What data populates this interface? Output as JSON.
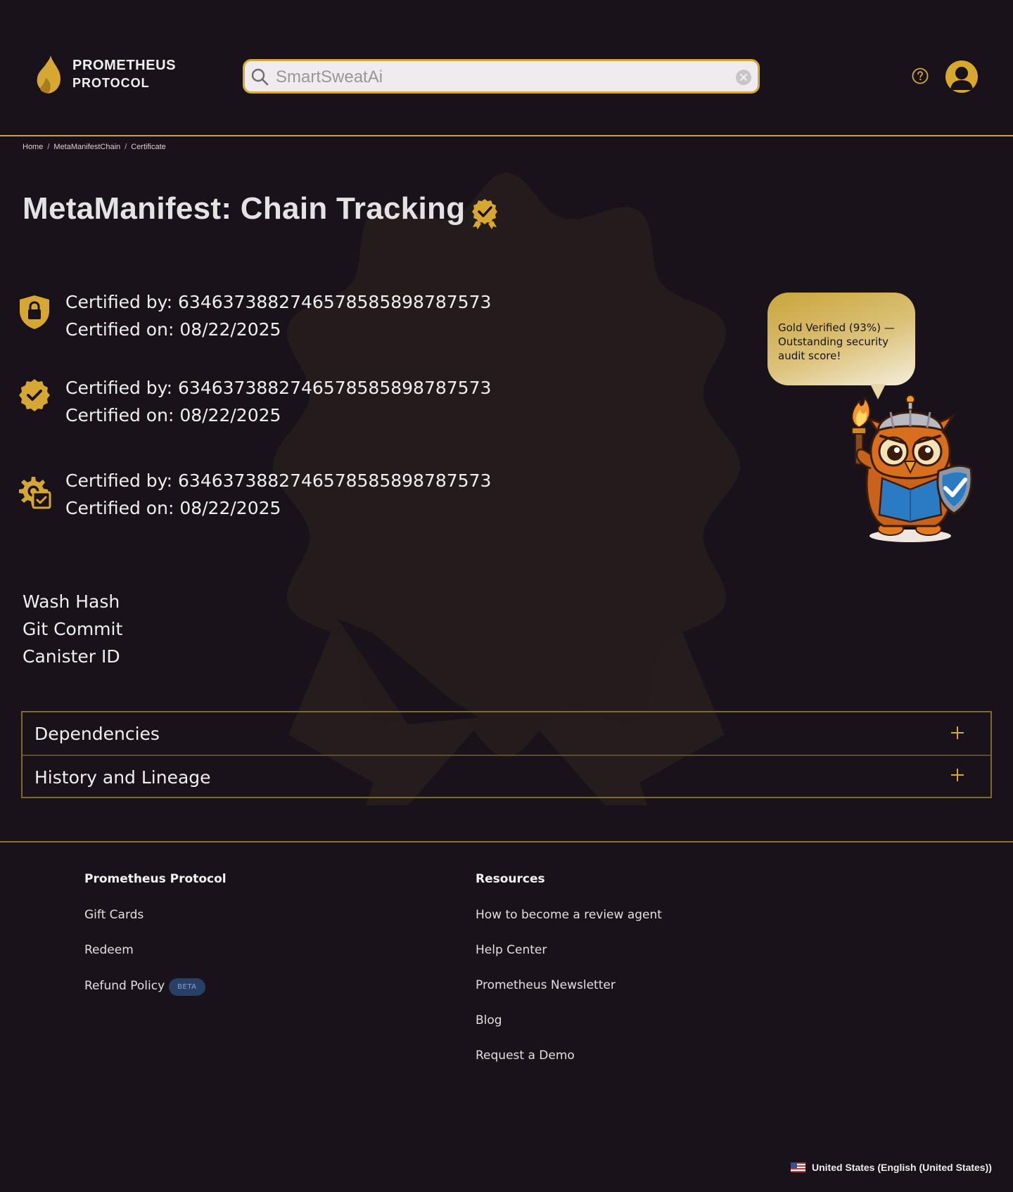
{
  "header": {
    "logo_line1": "PROMETHEUS",
    "logo_line2": "PROTOCOL",
    "search_value": "SmartSweatAi"
  },
  "breadcrumb": [
    "Home",
    "MetaManifestChain",
    "Certificate"
  ],
  "title": "MetaManifest: Chain Tracking",
  "certifications": [
    {
      "icon": "shield-lock-icon",
      "by": "Certified by: 6346373882746578585898787573",
      "on": "Certified on: 08/22/2025"
    },
    {
      "icon": "verified-badge-icon",
      "by": "Certified by: 6346373882746578585898787573",
      "on": "Certified on: 08/22/2025"
    },
    {
      "icon": "gear-check-icon",
      "by": "Certified by: 6346373882746578585898787573",
      "on": "Certified on: 08/22/2025"
    }
  ],
  "mascot": {
    "bubble_text": "Gold Verified (93%) — Outstanding security audit score!"
  },
  "hashes": [
    "Wash Hash",
    "Git Commit",
    "Canister ID"
  ],
  "accordion": [
    "Dependencies",
    "History and Lineage"
  ],
  "footer": {
    "col1": {
      "heading": "Prometheus Protocol",
      "links": [
        "Gift Cards",
        "Redeem",
        "Refund Policy"
      ],
      "badge": "BETA"
    },
    "col2": {
      "heading": "Resources",
      "links": [
        "How to become a review agent",
        "Help Center",
        "Prometheus Newsletter",
        "Blog",
        "Request a Demo"
      ]
    },
    "locale": "United States (English (United States))"
  },
  "colors": {
    "background": "#19121a",
    "accent_gold": "#d4a935",
    "beta_badge": "#2a3f66"
  }
}
